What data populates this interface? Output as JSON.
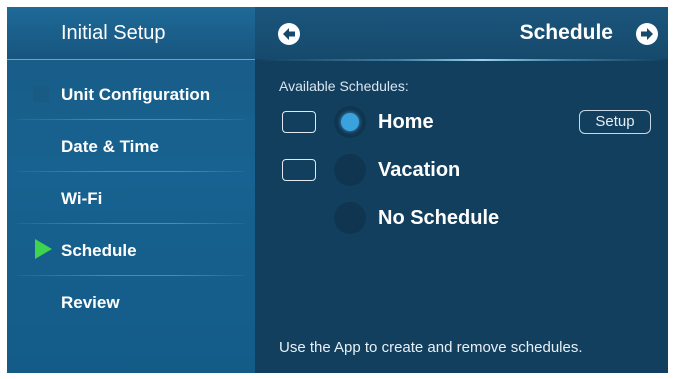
{
  "sidebar": {
    "title": "Initial Setup",
    "items": [
      {
        "label": "Unit Configuration"
      },
      {
        "label": "Date & Time"
      },
      {
        "label": "Wi-Fi"
      },
      {
        "label": "Schedule",
        "active": true
      },
      {
        "label": "Review"
      }
    ]
  },
  "main": {
    "title": "Schedule",
    "section_label": "Available Schedules:",
    "options": [
      {
        "label": "Home",
        "selected": true,
        "has_checkbox": true
      },
      {
        "label": "Vacation",
        "selected": false,
        "has_checkbox": true
      },
      {
        "label": "No Schedule",
        "selected": false,
        "has_checkbox": false
      }
    ],
    "setup_label": "Setup",
    "footer_text": "Use the App to create and remove schedules."
  },
  "icons": {
    "back": "arrow-left-circle-icon",
    "forward": "arrow-right-circle-icon",
    "active_marker": "play-triangle-icon"
  },
  "colors": {
    "active_marker": "#3ed44e",
    "selected_radio": "#3aa3dd",
    "background": "#133f5e",
    "sidebar": "#176290"
  }
}
